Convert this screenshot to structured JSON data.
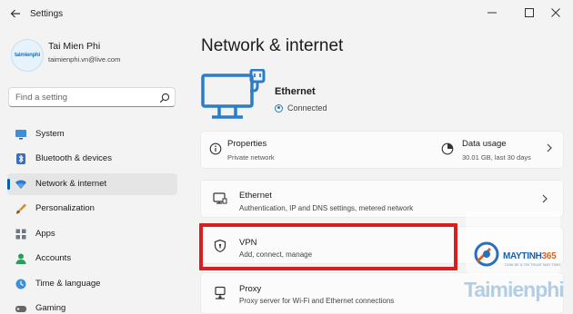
{
  "window": {
    "title": "Settings"
  },
  "user": {
    "name": "Tai Mien Phi",
    "email": "taimienphi.vn@live.com",
    "avatar_logo": "taimienphi"
  },
  "search": {
    "placeholder": "Find a setting"
  },
  "sidebar": {
    "items": [
      {
        "label": "System",
        "icon": "monitor-icon"
      },
      {
        "label": "Bluetooth & devices",
        "icon": "bluetooth-icon"
      },
      {
        "label": "Network & internet",
        "icon": "wifi-icon",
        "active": true
      },
      {
        "label": "Personalization",
        "icon": "brush-icon"
      },
      {
        "label": "Apps",
        "icon": "apps-icon"
      },
      {
        "label": "Accounts",
        "icon": "person-icon"
      },
      {
        "label": "Time & language",
        "icon": "globe-clock-icon"
      },
      {
        "label": "Gaming",
        "icon": "gamepad-icon"
      }
    ]
  },
  "main": {
    "title": "Network & internet",
    "connection": {
      "name": "Ethernet",
      "status": "Connected"
    },
    "properties": {
      "title": "Properties",
      "subtitle": "Private network"
    },
    "data_usage": {
      "title": "Data usage",
      "subtitle": "30.01 GB, last 30 days"
    },
    "cards": [
      {
        "title": "Ethernet",
        "subtitle": "Authentication, IP and DNS settings, metered network",
        "icon": "ethernet-port-icon"
      },
      {
        "title": "VPN",
        "subtitle": "Add, connect, manage",
        "icon": "shield-icon"
      },
      {
        "title": "Proxy",
        "subtitle": "Proxy server for Wi-Fi and Ethernet connections",
        "icon": "proxy-monitor-icon"
      }
    ]
  },
  "watermark": {
    "brand_main": "MAYTINH",
    "brand_num": "365",
    "tagline": "CHIA SE & TIN THUAT MAY TINH",
    "site": "Taimienphi"
  },
  "colors": {
    "accent": "#005fb8",
    "highlight_border": "#d62020",
    "window_bg": "#f3f3f3",
    "card_bg": "#fbfbfb"
  }
}
